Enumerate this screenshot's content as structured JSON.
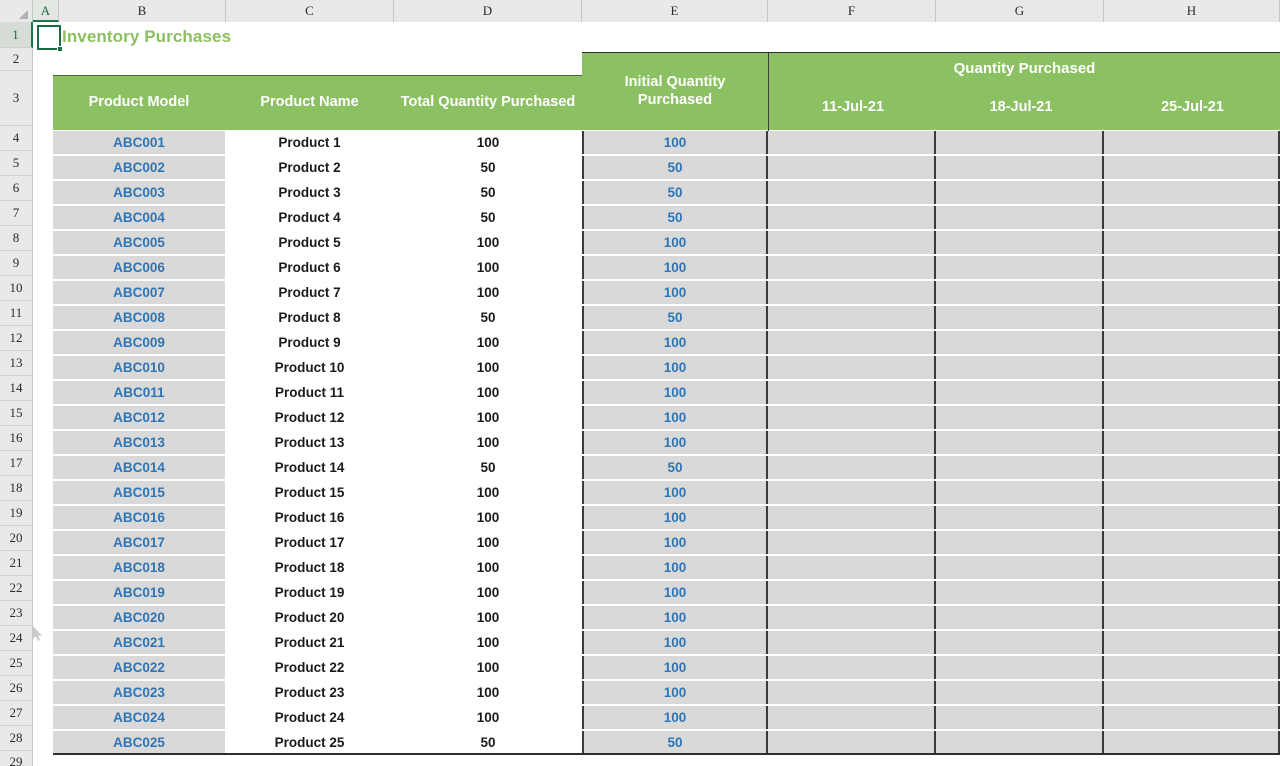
{
  "app": {
    "type": "spreadsheet"
  },
  "colors": {
    "header_green": "#8CC163",
    "title_green": "#8CBF5F",
    "value_blue": "#2E75B6",
    "cell_gray": "#d9d9d9",
    "selection_green": "#1d6b43"
  },
  "column_headers": [
    "A",
    "B",
    "C",
    "D",
    "E",
    "F",
    "G",
    "H"
  ],
  "row_headers": [
    "1",
    "2",
    "3",
    "4",
    "5",
    "6",
    "7",
    "8",
    "9",
    "10",
    "11",
    "12",
    "13",
    "14",
    "15",
    "16",
    "17",
    "18",
    "19",
    "20",
    "21",
    "22",
    "23",
    "24",
    "25",
    "26",
    "27",
    "28",
    "29"
  ],
  "selected_cell": "A1",
  "title": "Inventory Purchases",
  "table": {
    "headers": {
      "product_model": "Product Model",
      "product_name": "Product Name",
      "total_quantity_purchased": "Total Quantity Purchased",
      "initial_quantity_purchased": "Initial Quantity Purchased",
      "group_title": "Quantity Purchased",
      "dates": [
        "11-Jul-21",
        "18-Jul-21",
        "25-Jul-21"
      ]
    },
    "rows": [
      {
        "row": "4",
        "model": "ABC001",
        "name": "Product 1",
        "total": "100",
        "initial": "100",
        "d1": "",
        "d2": "",
        "d3": ""
      },
      {
        "row": "5",
        "model": "ABC002",
        "name": "Product 2",
        "total": "50",
        "initial": "50",
        "d1": "",
        "d2": "",
        "d3": ""
      },
      {
        "row": "6",
        "model": "ABC003",
        "name": "Product 3",
        "total": "50",
        "initial": "50",
        "d1": "",
        "d2": "",
        "d3": ""
      },
      {
        "row": "7",
        "model": "ABC004",
        "name": "Product 4",
        "total": "50",
        "initial": "50",
        "d1": "",
        "d2": "",
        "d3": ""
      },
      {
        "row": "8",
        "model": "ABC005",
        "name": "Product 5",
        "total": "100",
        "initial": "100",
        "d1": "",
        "d2": "",
        "d3": ""
      },
      {
        "row": "9",
        "model": "ABC006",
        "name": "Product 6",
        "total": "100",
        "initial": "100",
        "d1": "",
        "d2": "",
        "d3": ""
      },
      {
        "row": "10",
        "model": "ABC007",
        "name": "Product 7",
        "total": "100",
        "initial": "100",
        "d1": "",
        "d2": "",
        "d3": ""
      },
      {
        "row": "11",
        "model": "ABC008",
        "name": "Product 8",
        "total": "50",
        "initial": "50",
        "d1": "",
        "d2": "",
        "d3": ""
      },
      {
        "row": "12",
        "model": "ABC009",
        "name": "Product 9",
        "total": "100",
        "initial": "100",
        "d1": "",
        "d2": "",
        "d3": ""
      },
      {
        "row": "13",
        "model": "ABC010",
        "name": "Product 10",
        "total": "100",
        "initial": "100",
        "d1": "",
        "d2": "",
        "d3": ""
      },
      {
        "row": "14",
        "model": "ABC011",
        "name": "Product 11",
        "total": "100",
        "initial": "100",
        "d1": "",
        "d2": "",
        "d3": ""
      },
      {
        "row": "15",
        "model": "ABC012",
        "name": "Product 12",
        "total": "100",
        "initial": "100",
        "d1": "",
        "d2": "",
        "d3": ""
      },
      {
        "row": "16",
        "model": "ABC013",
        "name": "Product 13",
        "total": "100",
        "initial": "100",
        "d1": "",
        "d2": "",
        "d3": ""
      },
      {
        "row": "17",
        "model": "ABC014",
        "name": "Product 14",
        "total": "50",
        "initial": "50",
        "d1": "",
        "d2": "",
        "d3": ""
      },
      {
        "row": "18",
        "model": "ABC015",
        "name": "Product 15",
        "total": "100",
        "initial": "100",
        "d1": "",
        "d2": "",
        "d3": ""
      },
      {
        "row": "19",
        "model": "ABC016",
        "name": "Product 16",
        "total": "100",
        "initial": "100",
        "d1": "",
        "d2": "",
        "d3": ""
      },
      {
        "row": "20",
        "model": "ABC017",
        "name": "Product 17",
        "total": "100",
        "initial": "100",
        "d1": "",
        "d2": "",
        "d3": ""
      },
      {
        "row": "21",
        "model": "ABC018",
        "name": "Product 18",
        "total": "100",
        "initial": "100",
        "d1": "",
        "d2": "",
        "d3": ""
      },
      {
        "row": "22",
        "model": "ABC019",
        "name": "Product 19",
        "total": "100",
        "initial": "100",
        "d1": "",
        "d2": "",
        "d3": ""
      },
      {
        "row": "23",
        "model": "ABC020",
        "name": "Product 20",
        "total": "100",
        "initial": "100",
        "d1": "",
        "d2": "",
        "d3": ""
      },
      {
        "row": "24",
        "model": "ABC021",
        "name": "Product 21",
        "total": "100",
        "initial": "100",
        "d1": "",
        "d2": "",
        "d3": ""
      },
      {
        "row": "25",
        "model": "ABC022",
        "name": "Product 22",
        "total": "100",
        "initial": "100",
        "d1": "",
        "d2": "",
        "d3": ""
      },
      {
        "row": "26",
        "model": "ABC023",
        "name": "Product 23",
        "total": "100",
        "initial": "100",
        "d1": "",
        "d2": "",
        "d3": ""
      },
      {
        "row": "27",
        "model": "ABC024",
        "name": "Product 24",
        "total": "100",
        "initial": "100",
        "d1": "",
        "d2": "",
        "d3": ""
      },
      {
        "row": "28",
        "model": "ABC025",
        "name": "Product 25",
        "total": "50",
        "initial": "50",
        "d1": "",
        "d2": "",
        "d3": ""
      }
    ]
  }
}
